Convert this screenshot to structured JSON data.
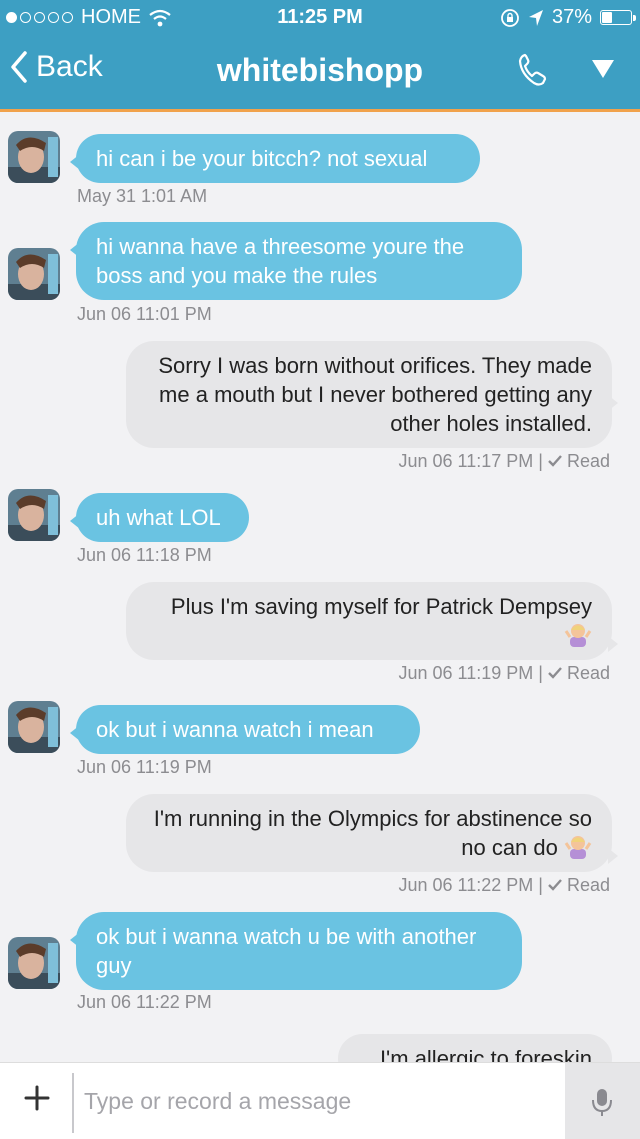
{
  "status_bar": {
    "carrier": "HOME",
    "time": "11:25 PM",
    "battery_percent": "37%",
    "battery_level": 0.37
  },
  "nav": {
    "back_label": "Back",
    "title": "whitebishopp"
  },
  "messages": [
    {
      "direction": "in",
      "text": "hi can i be your bitcch? not sexual",
      "timestamp": "May 31 1:01 AM"
    },
    {
      "direction": "in",
      "text": "hi wanna have a threesome youre the boss and you make the rules",
      "timestamp": "Jun 06 11:01 PM"
    },
    {
      "direction": "out",
      "text": "Sorry I was born without orifices. They made me a mouth but I never bothered getting any other holes installed.",
      "timestamp": "Jun 06 11:17 PM",
      "read_label": "Read"
    },
    {
      "direction": "in",
      "text": "uh what LOL",
      "timestamp": "Jun 06 11:18 PM"
    },
    {
      "direction": "out",
      "text": "Plus I'm saving myself for Patrick Dempsey",
      "timestamp": "Jun 06 11:19 PM",
      "read_label": "Read",
      "emoji": "shrug-emoji"
    },
    {
      "direction": "in",
      "text": "ok but i wanna watch i mean",
      "timestamp": "Jun 06 11:19 PM"
    },
    {
      "direction": "out",
      "text": "I'm running in the Olympics for abstinence so no can do",
      "timestamp": "Jun 06 11:22 PM",
      "read_label": "Read",
      "emoji": "shrug-emoji"
    },
    {
      "direction": "in",
      "text": "ok but i wanna watch u be with another guy",
      "timestamp": "Jun 06 11:22 PM"
    },
    {
      "direction": "out",
      "text": "I'm allergic to foreskin"
    }
  ],
  "composer": {
    "placeholder": "Type or record a message"
  },
  "colors": {
    "header": "#3d9fc3",
    "accent": "#f1a24b",
    "incoming_bubble": "#6ac3e2",
    "outgoing_bubble": "#e6e6e8",
    "background": "#f2f2f4"
  },
  "icons": [
    "signal-dots-icon",
    "wifi-icon",
    "rotation-lock-icon",
    "location-arrow-icon",
    "battery-icon",
    "back-chevron-icon",
    "phone-icon",
    "dropdown-triangle-icon",
    "plus-icon",
    "microphone-icon",
    "checkmark-icon"
  ]
}
